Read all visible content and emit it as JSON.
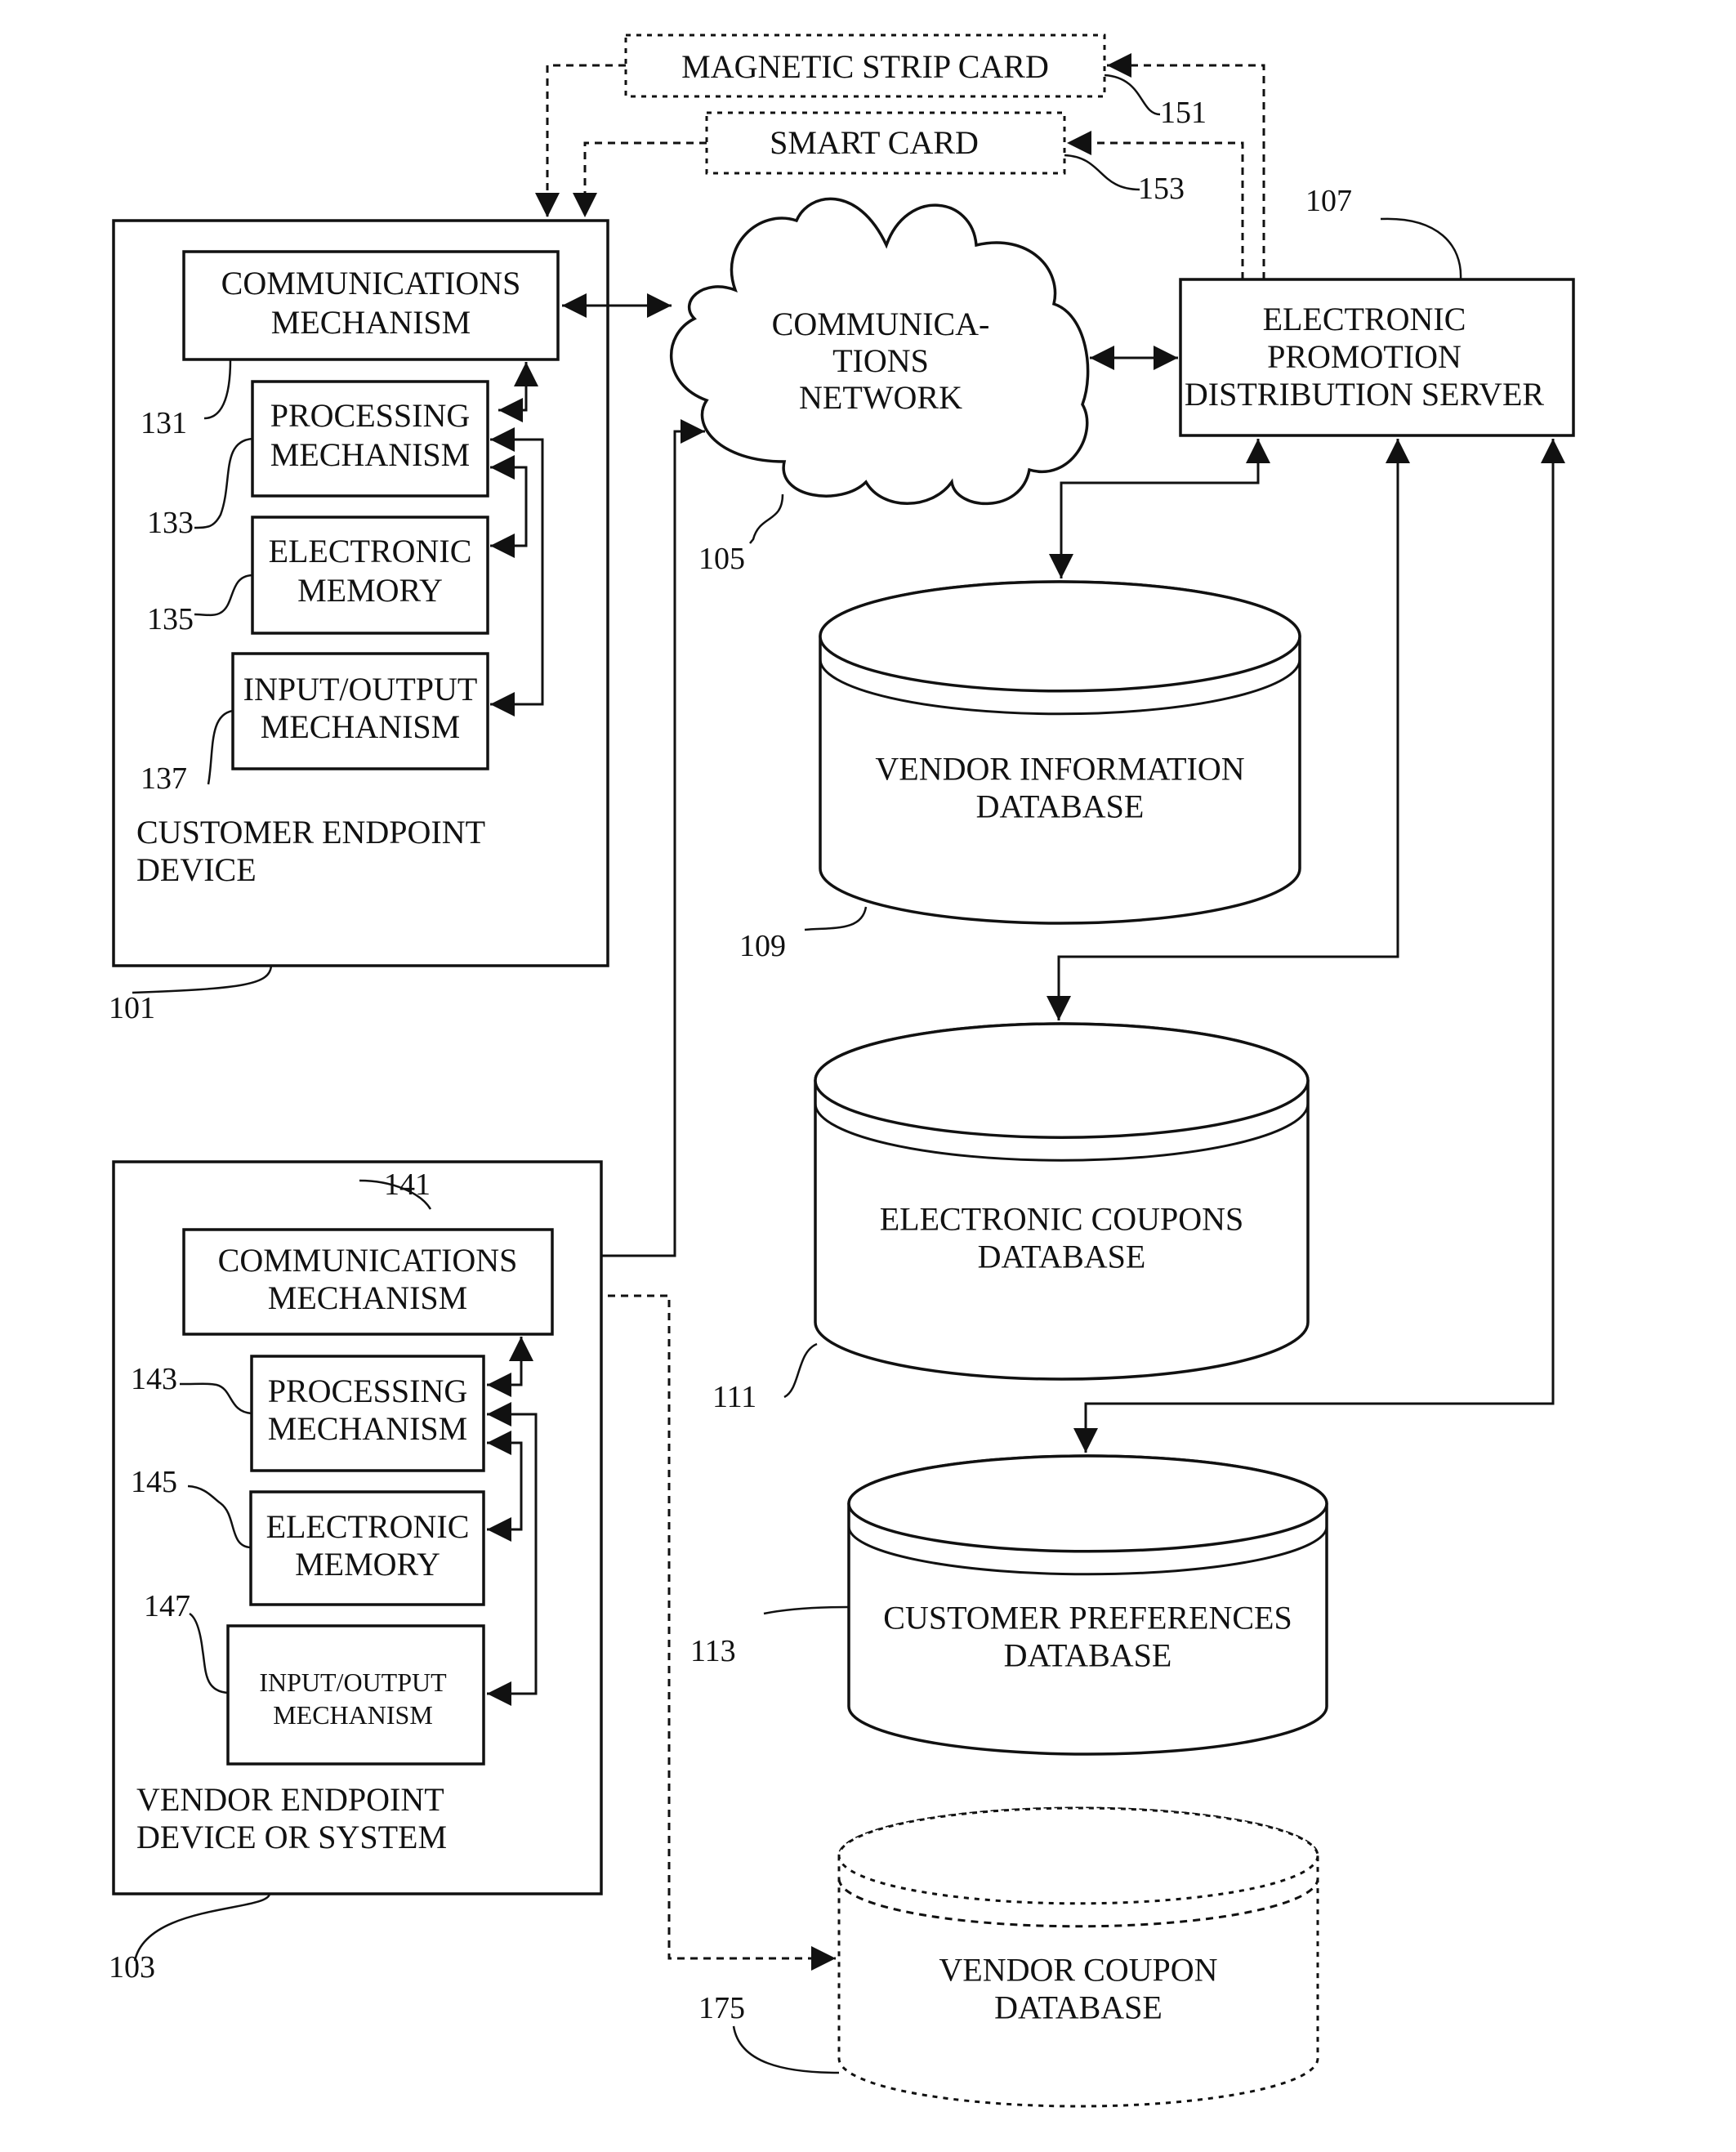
{
  "figure": {
    "customer_device": {
      "ref": "101",
      "label_lines": [
        "CUSTOMER ENDPOINT",
        "DEVICE"
      ],
      "components": [
        {
          "ref": "131",
          "lines": [
            "COMMUNICATIONS",
            "MECHANISM"
          ]
        },
        {
          "ref": "133",
          "lines": [
            "PROCESSING",
            "MECHANISM"
          ]
        },
        {
          "ref": "135",
          "lines": [
            "ELECTRONIC",
            "MEMORY"
          ]
        },
        {
          "ref": "137",
          "lines": [
            "INPUT/OUTPUT",
            "MECHANISM"
          ]
        }
      ]
    },
    "vendor_device": {
      "ref": "103",
      "label_lines": [
        "VENDOR ENDPOINT",
        "DEVICE OR SYSTEM"
      ],
      "components": [
        {
          "ref": "141",
          "lines": [
            "COMMUNICATIONS",
            "MECHANISM"
          ]
        },
        {
          "ref": "143",
          "lines": [
            "PROCESSING",
            "MECHANISM"
          ]
        },
        {
          "ref": "145",
          "lines": [
            "ELECTRONIC",
            "MEMORY"
          ]
        },
        {
          "ref": "147",
          "lines": [
            "INPUT/OUTPUT",
            "MECHANISM"
          ]
        }
      ]
    },
    "network": {
      "ref": "105",
      "lines": [
        "COMMUNICA-",
        "TIONS",
        "NETWORK"
      ]
    },
    "server": {
      "ref": "107",
      "lines": [
        "ELECTRONIC",
        "PROMOTION",
        "DISTRIBUTION SERVER"
      ]
    },
    "magnetic_card": {
      "ref": "151",
      "label": "MAGNETIC STRIP CARD"
    },
    "smart_card": {
      "ref": "153",
      "label": "SMART CARD"
    },
    "databases": [
      {
        "ref": "109",
        "lines": [
          "VENDOR INFORMATION",
          "DATABASE"
        ],
        "style": "solid"
      },
      {
        "ref": "111",
        "lines": [
          "ELECTRONIC COUPONS",
          "DATABASE"
        ],
        "style": "solid"
      },
      {
        "ref": "113",
        "lines": [
          "CUSTOMER PREFERENCES",
          "DATABASE"
        ],
        "style": "solid"
      },
      {
        "ref": "175",
        "lines": [
          "VENDOR COUPON",
          "DATABASE"
        ],
        "style": "dashed"
      }
    ]
  }
}
